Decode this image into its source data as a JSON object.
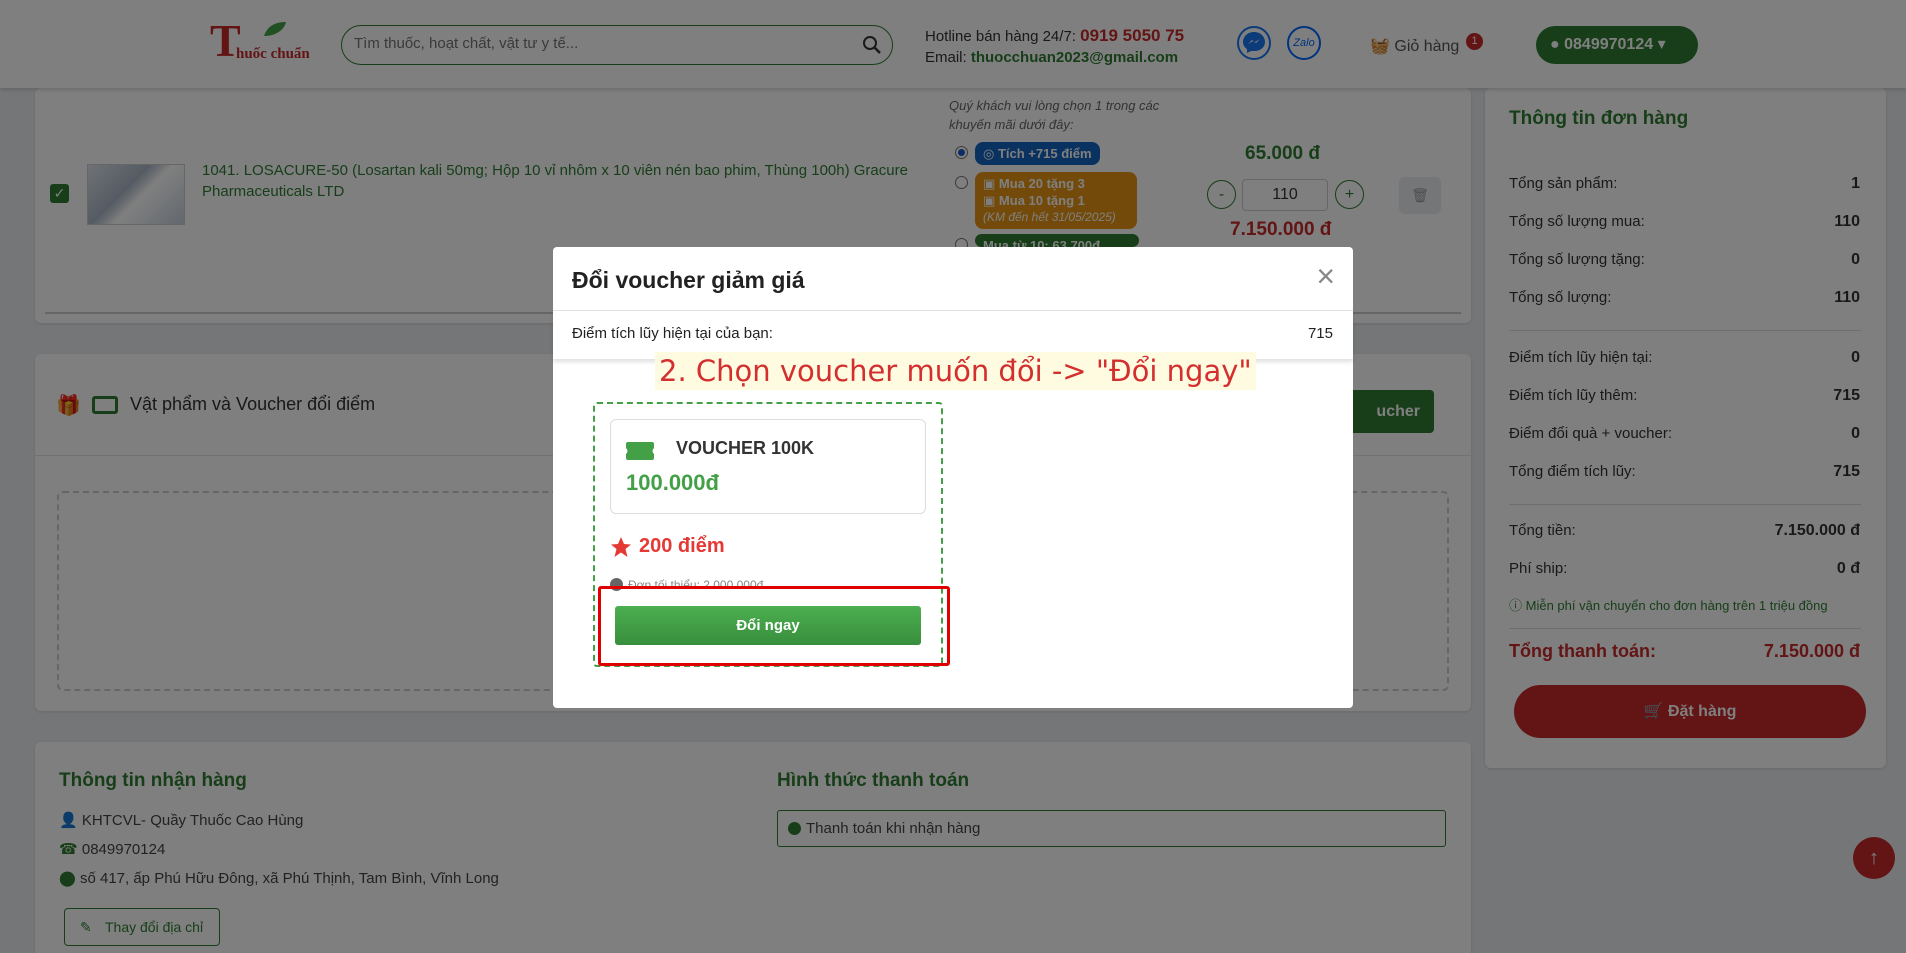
{
  "header": {
    "logo_letter": "T",
    "logo_text": "huốc chuẩn",
    "search_placeholder": "Tìm thuốc, hoạt chất, vật tư y tế...",
    "hotline_label": "Hotline bán hàng 24/7:",
    "hotline_number": "0919 5050 75",
    "email_label": "Email:",
    "email_value": "thuocchuan2023@gmail.com",
    "zalo_label": "Zalo",
    "cart_label": "Giỏ hàng",
    "cart_count": "1",
    "user_phone": "0849970124"
  },
  "product": {
    "name": "1041. LOSACURE-50 (Losartan kali 50mg; Hộp 10 vỉ nhôm x 10 viên nén bao phim, Thùng 100h) Gracure Pharmaceuticals LTD",
    "promo_note": "Quý khách vui lòng chọn 1 trong các khuyến mãi dưới đây:",
    "promo_1": "Tích +715 điểm",
    "promo_2_line1": "Mua 20 tặng 3",
    "promo_2_line2": "Mua 10 tặng 1",
    "promo_2_line3": "(KM đến hết 31/05/2025)",
    "promo_3": "Mua từ 10: 63.700đ",
    "unit_price": "65.000 đ",
    "quantity": "110",
    "minus": "-",
    "plus": "+",
    "line_total": "7.150.000 đ"
  },
  "voucher_section": {
    "title": "Vật phẩm và Voucher đổi điểm",
    "button_partial": "ucher"
  },
  "receive": {
    "title": "Thông tin nhận hàng",
    "name": "KHTCVL- Quầy Thuốc Cao Hùng",
    "phone": "0849970124",
    "address": "số 417, ấp Phú Hữu Đông, xã Phú Thịnh, Tam Bình, Vĩnh Long",
    "change_button": "Thay đổi địa chỉ",
    "payment_title": "Hình thức thanh toán",
    "payment_method": "Thanh toán khi nhận hàng"
  },
  "summary": {
    "title": "Thông tin đơn hàng",
    "rows": [
      {
        "label": "Tổng sản phẩm:",
        "value": "1"
      },
      {
        "label": "Tổng số lượng mua:",
        "value": "110"
      },
      {
        "label": "Tổng số lượng tặng:",
        "value": "0"
      },
      {
        "label": "Tổng số lượng:",
        "value": "110"
      },
      {
        "label": "Điểm tích lũy hiện tại:",
        "value": "0"
      },
      {
        "label": "Điểm tích lũy thêm:",
        "value": "715"
      },
      {
        "label": "Điểm đổi quà + voucher:",
        "value": "0"
      },
      {
        "label": "Tổng điểm tích lũy:",
        "value": "715"
      },
      {
        "label": "Tổng tiền:",
        "value": "7.150.000 đ"
      },
      {
        "label": "Phí ship:",
        "value": "0 đ"
      }
    ],
    "free_ship_note": "Miễn phí vận chuyển cho đơn hàng trên 1 triệu đồng",
    "grand_label": "Tổng thanh toán:",
    "grand_value": "7.150.000 đ",
    "order_button": "Đặt hàng"
  },
  "modal": {
    "title": "Đổi voucher giảm giá",
    "close": "×",
    "points_label": "Điểm tích lũy hiện tại của bạn:",
    "points_value": "715",
    "voucher": {
      "name": "VOUCHER 100K",
      "value": "100.000đ",
      "points": "200 điểm",
      "min_order": "Đơn tối thiểu: 2.000.000đ",
      "redeem_button": "Đổi ngay"
    }
  },
  "annotation": "2. Chọn voucher muốn đổi -> \"Đổi ngay\"",
  "colors": {
    "brand_green": "#2e7d32",
    "brand_red": "#c62828",
    "highlight_red": "#e00000"
  }
}
